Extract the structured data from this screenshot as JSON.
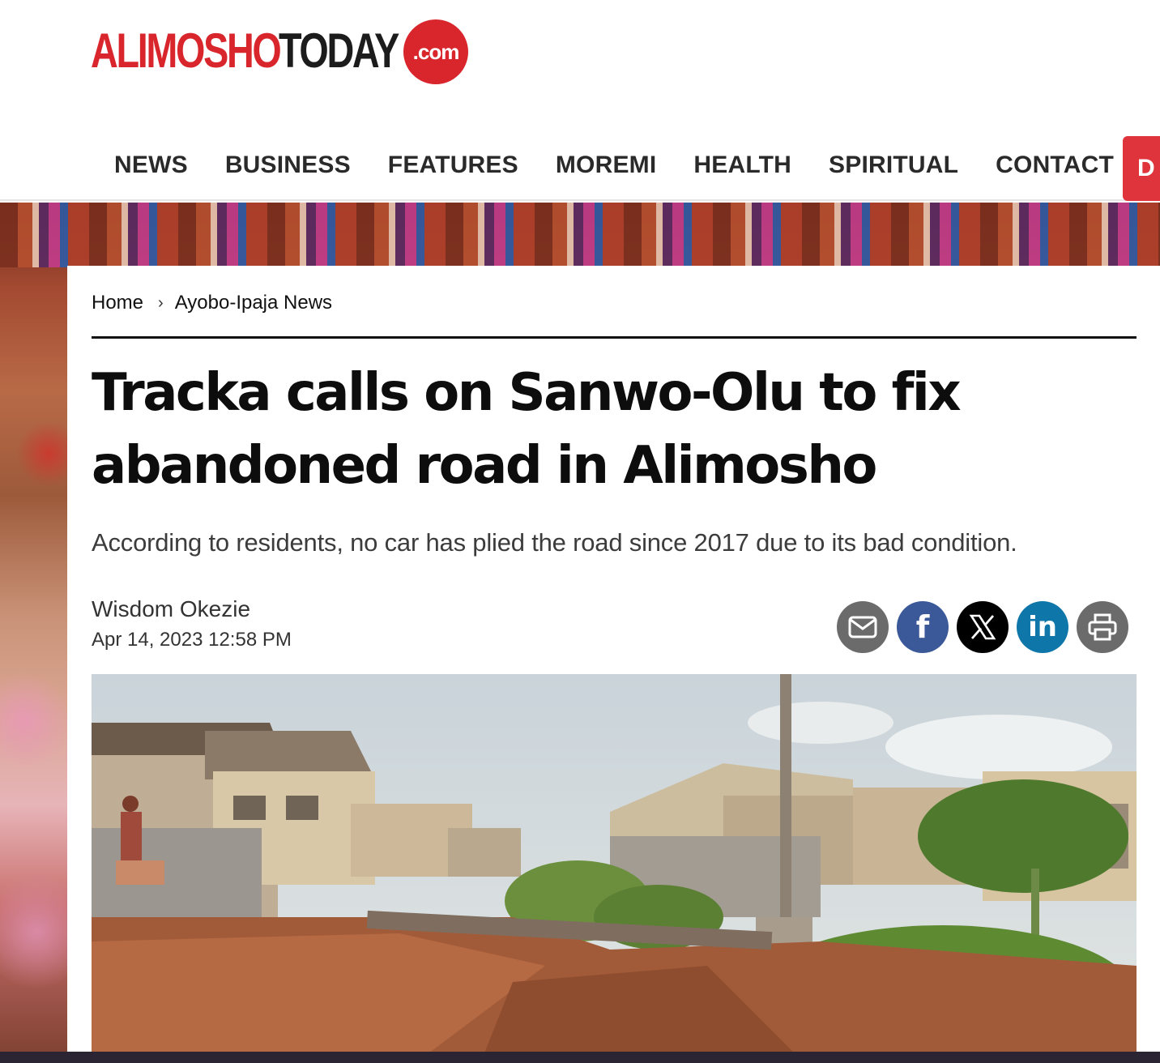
{
  "site": {
    "logo_part1": "ALIMOSHO",
    "logo_part2": "TODAY",
    "logo_suffix": ".com",
    "brand_color": "#d8262c"
  },
  "nav": {
    "items": [
      "NEWS",
      "BUSINESS",
      "FEATURES",
      "MOREMI",
      "HEALTH",
      "SPIRITUAL",
      "CONTACT"
    ],
    "cta_label": "D"
  },
  "breadcrumb": {
    "home": "Home",
    "section": "Ayobo-Ipaja News"
  },
  "article": {
    "headline": "Tracka calls on Sanwo-Olu to fix abandoned road in Alimosho",
    "dek": "According to residents, no car has plied the road since 2017 due to its bad condition.",
    "author": "Wisdom Okezie",
    "date": "Apr 14, 2023 12:58 PM"
  },
  "share": {
    "buttons": [
      {
        "icon": "envelope-icon",
        "color": "#6b6b6b"
      },
      {
        "icon": "facebook-icon",
        "color": "#3b5998",
        "glyph": "f"
      },
      {
        "icon": "x-icon",
        "color": "#000000"
      },
      {
        "icon": "linkedin-icon",
        "color": "#0e76a8",
        "glyph": "in"
      },
      {
        "icon": "printer-icon",
        "color": "#6b6b6b"
      }
    ]
  }
}
